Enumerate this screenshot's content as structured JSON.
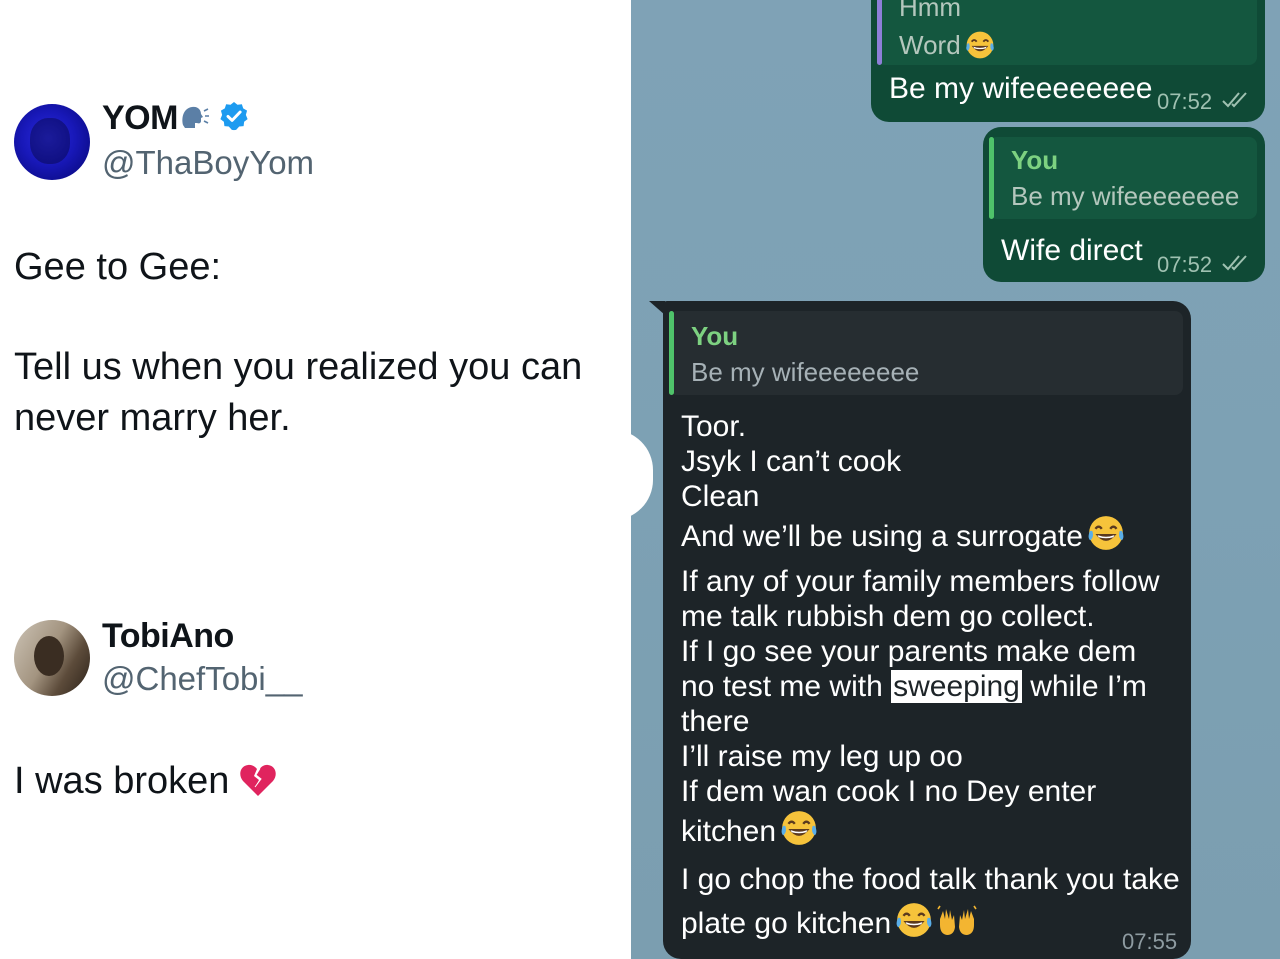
{
  "tweet": {
    "author": {
      "name": "YOM",
      "handle": "@ThaBoyYom"
    },
    "text_line1": "Gee to Gee:",
    "text_line2": "Tell us when you realized you can never marry her."
  },
  "reply": {
    "author": {
      "name": "TobiAno",
      "handle": "@ChefTobi__"
    },
    "text": "I was broken"
  },
  "chat": {
    "msg1": {
      "quote_line1": "Hmm",
      "quote_line2": "Word",
      "text": "Be my wifeeeeeeee",
      "time": "07:52"
    },
    "msg2": {
      "quote_sender": "You",
      "quote_text": "Be my wifeeeeeeee",
      "text": "Wife direct",
      "time": "07:52"
    },
    "msg3": {
      "quote_sender": "You",
      "quote_text": "Be my wifeeeeeeee",
      "lines": {
        "l1": "Toor.",
        "l2": "Jsyk I can’t cook",
        "l3": "Clean",
        "l4": "And we’ll be using a surrogate",
        "l5": "If any of your family members follow",
        "l6": "me talk rubbish dem go collect.",
        "l7": "If I go see your parents make dem",
        "l8a": "no test me with ",
        "l8b": "sweeping",
        "l8c": " while I’m",
        "l9": "there",
        "l10": "I’ll raise my leg up oo",
        "l11": "If dem wan cook I no Dey enter",
        "l12": "kitchen",
        "l13": "I go chop the food talk thank you take",
        "l14": "plate go kitchen"
      },
      "time": "07:55"
    }
  },
  "icons": [
    "speaking-head-icon",
    "verified-badge-icon",
    "broken-heart-icon",
    "laughing-tears-emoji-icon",
    "raised-hands-emoji-icon",
    "double-check-icon"
  ],
  "colors": {
    "outgoing_bubble": "#0f4a36",
    "incoming_bubble": "#1d2428",
    "chat_background": "#7fa2b6",
    "verified": "#1d9bf0",
    "handle_gray": "#536471"
  }
}
